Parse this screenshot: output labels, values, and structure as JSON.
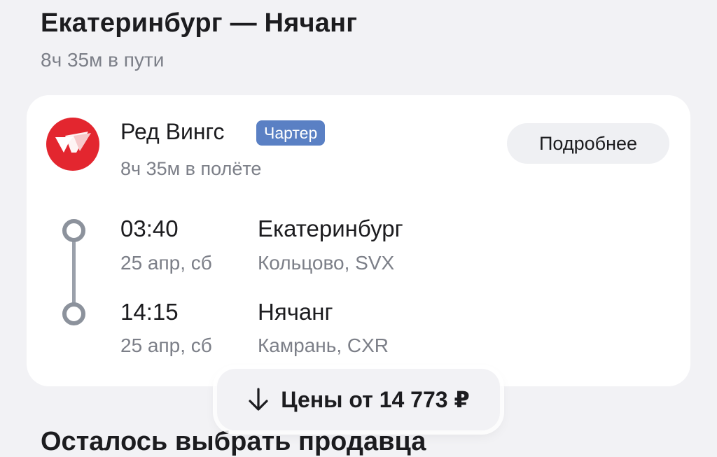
{
  "header": {
    "route_title": "Екатеринбург — Нячанг",
    "total_duration": "8ч 35м в пути"
  },
  "flight_card": {
    "airline": {
      "name": "Ред Вингс",
      "badge": "Чартер",
      "logo_icon": "red-wings-logo",
      "logo_color": "#e3262f"
    },
    "flight_duration": "8ч 35м в полёте",
    "details_button": "Подробнее",
    "departure": {
      "time": "03:40",
      "date": "25 апр, сб",
      "city": "Екатеринбург",
      "airport": "Кольцово, SVX"
    },
    "arrival": {
      "time": "14:15",
      "date": "25 апр, сб",
      "city": "Нячанг",
      "airport": "Камрань, CXR"
    }
  },
  "prices_button": {
    "icon": "arrow-down-icon",
    "label": "Цены от 14 773 ₽"
  },
  "section": {
    "heading": "Осталось выбрать продавца"
  }
}
